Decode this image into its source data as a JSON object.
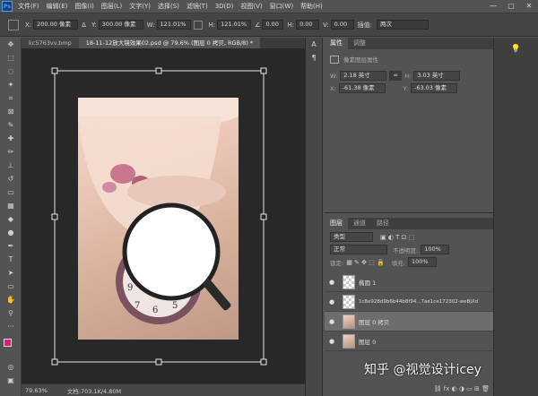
{
  "app": {
    "logo": "Ps"
  },
  "menu": [
    "文件(F)",
    "编辑(E)",
    "图像(I)",
    "图层(L)",
    "文字(Y)",
    "选择(S)",
    "滤镜(T)",
    "3D(D)",
    "视图(V)",
    "窗口(W)",
    "帮助(H)"
  ],
  "window_controls": [
    "—",
    "▢",
    "✕"
  ],
  "options": {
    "x_label": "X:",
    "x_value": "200.00 像素",
    "y_label": "Y:",
    "y_value": "300.00 像素",
    "w_label": "W:",
    "w_value": "121.01%",
    "h_label": "H:",
    "h_value": "121.01%",
    "angle_value": "0.00",
    "hskew_label": "H:",
    "hskew_value": "0.00",
    "vskew_label": "V:",
    "vskew_value": "0.00",
    "interp_label": "插值:",
    "interp_value": "两次"
  },
  "tabs": [
    {
      "label": "kc5763vv.bmp",
      "active": false
    },
    {
      "label": "18-11-12放大镜效果02.psd @ 79.6% (图层 0 拷贝, RGB/8) *",
      "active": true
    }
  ],
  "status": {
    "zoom": "79.63%",
    "doc": "文档:703.1K/4.80M"
  },
  "properties": {
    "tabs": [
      "属性",
      "调整"
    ],
    "subtitle": "像素图层属性",
    "w_label": "W:",
    "w_value": "2.18 英寸",
    "h_label": "H:",
    "h_value": "3.03 英寸",
    "x_label": "X:",
    "x_value": "-61.38 像素",
    "y_label": "Y:",
    "y_value": "-63.03 像素"
  },
  "layers": {
    "tabs": [
      "图层",
      "通道",
      "路径"
    ],
    "kind_label": "类型",
    "blend_mode": "正常",
    "opacity_label": "不透明度:",
    "opacity_value": "100%",
    "lock_label": "锁定:",
    "fill_label": "填充:",
    "fill_value": "100%",
    "items": [
      {
        "name": "椭圆 1",
        "selected": false,
        "thumb": "transparent"
      },
      {
        "name": "1c8e928d9b6b44b8f94...7ae1ce172302-weBjXd",
        "selected": false,
        "thumb": "transparent"
      },
      {
        "name": "图层 0 拷贝",
        "selected": true,
        "thumb": "image"
      },
      {
        "name": "图层 0",
        "selected": false,
        "thumb": "image"
      }
    ]
  },
  "watermark": "知乎 @视觉设计icey",
  "colors": {
    "foreground": "#e0197d",
    "background": "#ffffff"
  }
}
